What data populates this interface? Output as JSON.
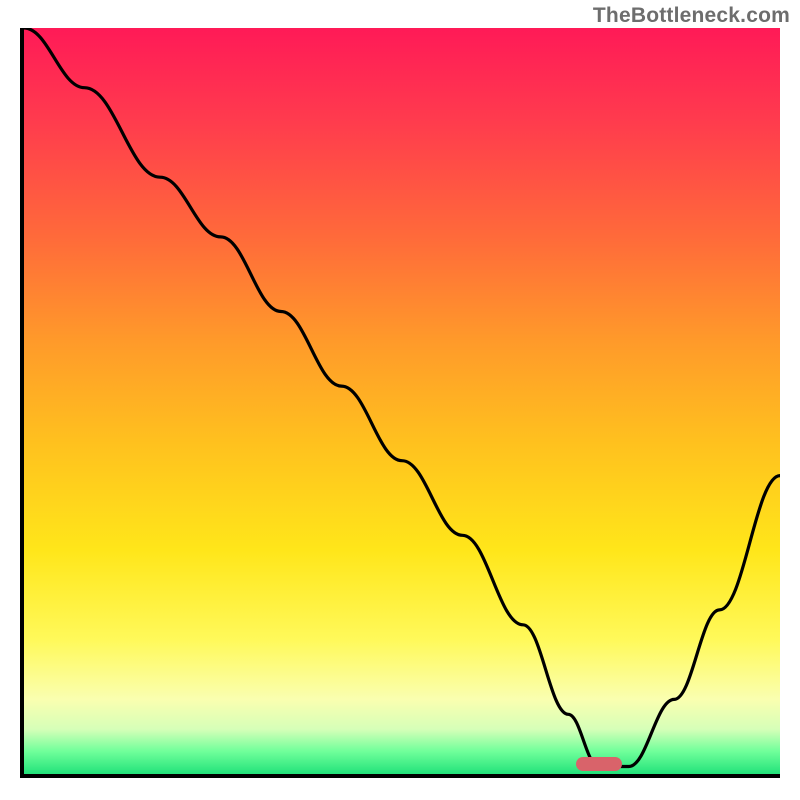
{
  "watermark": "TheBottleneck.com",
  "chart_data": {
    "type": "line",
    "title": "",
    "xlabel": "",
    "ylabel": "",
    "xlim": [
      0,
      100
    ],
    "ylim": [
      0,
      100
    ],
    "series": [
      {
        "name": "bottleneck-curve",
        "x": [
          0,
          8,
          18,
          26,
          34,
          42,
          50,
          58,
          66,
          72,
          76,
          80,
          86,
          92,
          100
        ],
        "values": [
          100,
          92,
          80,
          72,
          62,
          52,
          42,
          32,
          20,
          8,
          1,
          1,
          10,
          22,
          40
        ]
      }
    ],
    "marker": {
      "x": 76,
      "y": 1
    },
    "gradient_stops": [
      {
        "pos": 0,
        "color": "#ff1a57"
      },
      {
        "pos": 12,
        "color": "#ff3a4e"
      },
      {
        "pos": 28,
        "color": "#ff6a3a"
      },
      {
        "pos": 42,
        "color": "#ff9a2a"
      },
      {
        "pos": 56,
        "color": "#ffc21e"
      },
      {
        "pos": 70,
        "color": "#ffe61a"
      },
      {
        "pos": 82,
        "color": "#fff95a"
      },
      {
        "pos": 90,
        "color": "#faffb0"
      },
      {
        "pos": 94,
        "color": "#d6ffb8"
      },
      {
        "pos": 97,
        "color": "#6fff9a"
      },
      {
        "pos": 100,
        "color": "#22e27a"
      }
    ]
  }
}
